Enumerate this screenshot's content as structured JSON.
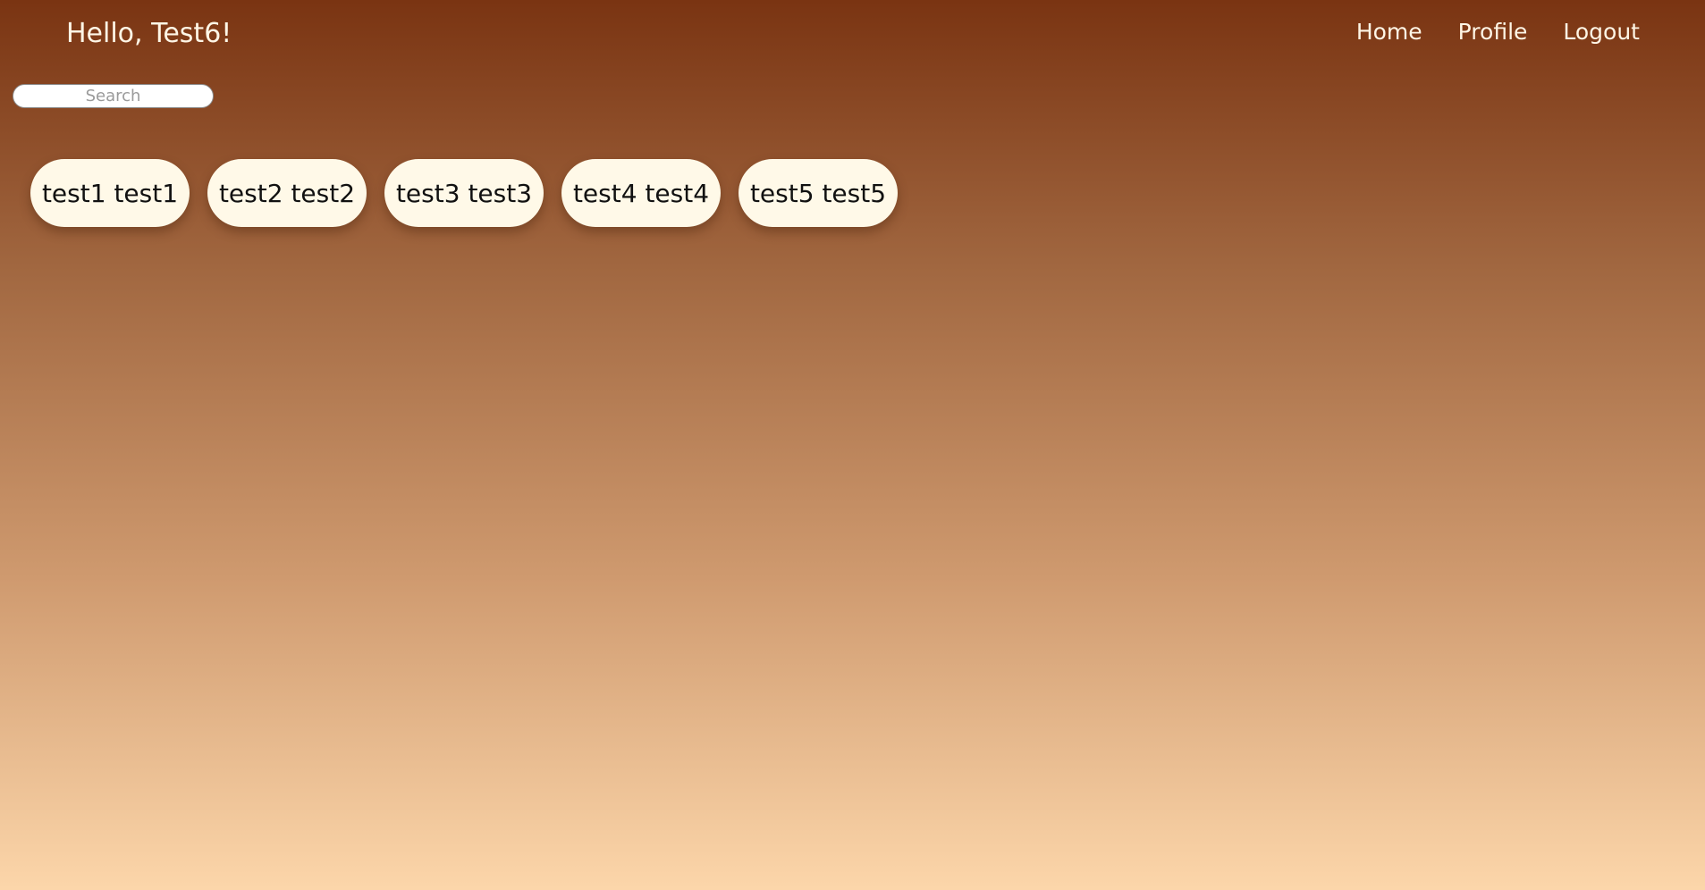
{
  "header": {
    "greeting": "Hello, Test6!",
    "nav": [
      {
        "label": "Home"
      },
      {
        "label": "Profile"
      },
      {
        "label": "Logout"
      }
    ]
  },
  "search": {
    "placeholder": "Search",
    "value": ""
  },
  "users": [
    {
      "label": "test1 test1"
    },
    {
      "label": "test2 test2"
    },
    {
      "label": "test3 test3"
    },
    {
      "label": "test4 test4"
    },
    {
      "label": "test5 test5"
    }
  ],
  "colors": {
    "gradient_top": "#7a3412",
    "gradient_bottom": "#fcd6aa",
    "chip_background": "#fff9e8",
    "header_text": "#fff6e6"
  }
}
